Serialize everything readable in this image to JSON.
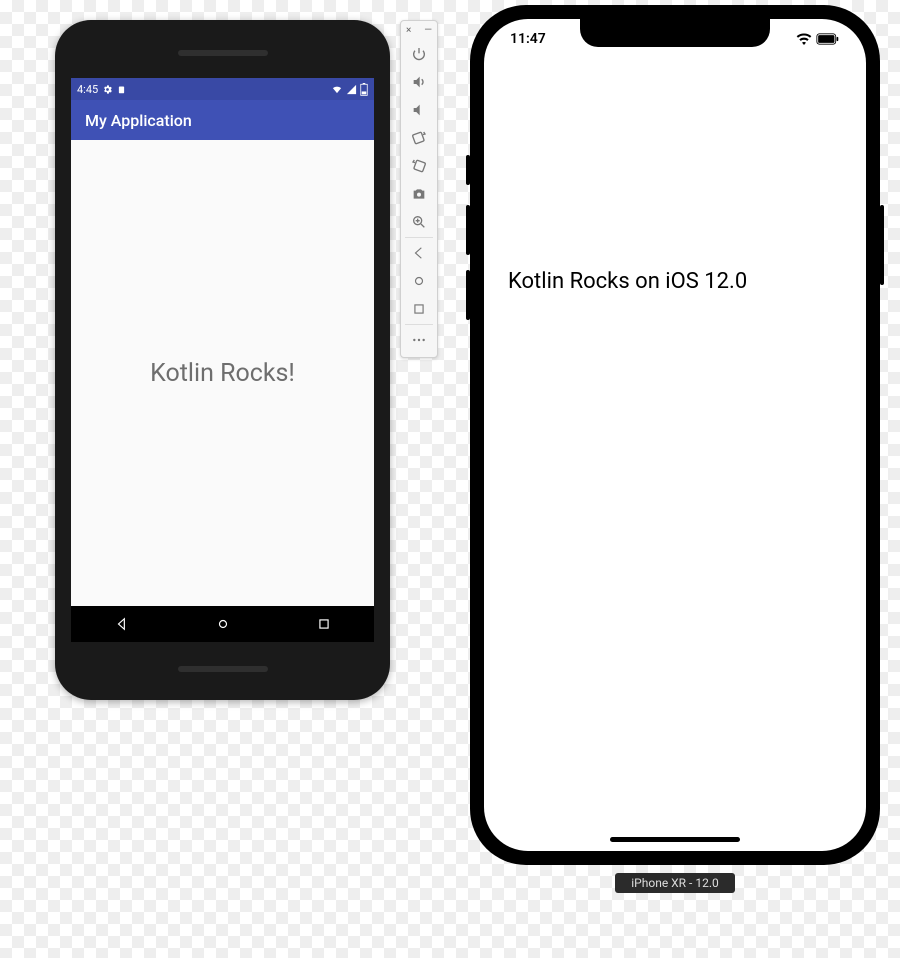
{
  "android": {
    "statusbar": {
      "time": "4:45"
    },
    "appbar": {
      "title": "My Application"
    },
    "content": {
      "message": "Kotlin Rocks!"
    }
  },
  "emulator_toolbar": {
    "close": "×",
    "minimize": "—"
  },
  "ios": {
    "statusbar": {
      "time": "11:47"
    },
    "content": {
      "message": "Kotlin Rocks on iOS 12.0"
    },
    "device_label": "iPhone XR - 12.0"
  }
}
